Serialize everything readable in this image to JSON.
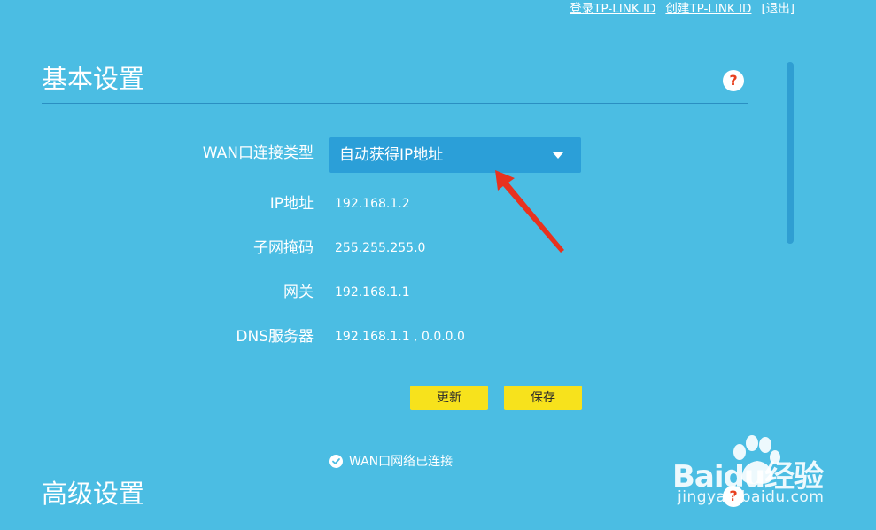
{
  "top_links": {
    "login": "登录TP-LINK ID",
    "create": "创建TP-LINK ID",
    "logout": "[退出]"
  },
  "basic": {
    "title": "基本设置",
    "wan_type_label": "WAN口连接类型",
    "wan_type_value": "自动获得IP地址",
    "ip_label": "IP地址",
    "ip_value": "192.168.1.2",
    "mask_label": "子网掩码",
    "mask_value": "255.255.255.0",
    "gateway_label": "网关",
    "gateway_value": "192.168.1.1",
    "dns_label": "DNS服务器",
    "dns_value": "192.168.1.1 , 0.0.0.0",
    "refresh_button": "更新",
    "save_button": "保存",
    "status_text": "WAN口网络已连接"
  },
  "advanced": {
    "title": "高级设置"
  },
  "help_glyph": "?",
  "watermark": {
    "brand": "Baidu经验",
    "sub": "jingyan.baidu.com"
  },
  "colors": {
    "background": "#4bbde3",
    "select_bg": "#2b9fd8",
    "button_bg": "#f7e21c",
    "arrow": "#e8321f",
    "help_icon": "#e8401f"
  }
}
